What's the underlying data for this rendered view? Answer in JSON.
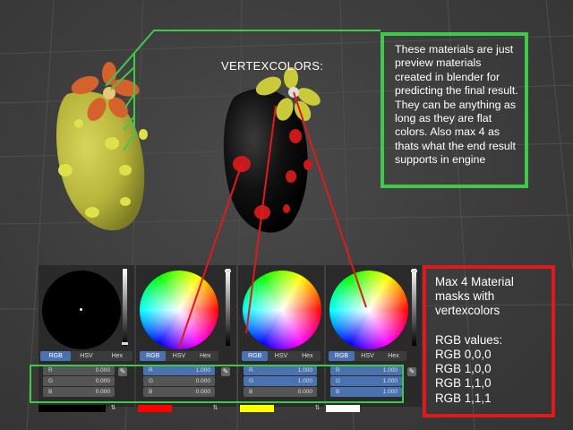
{
  "viewport": {
    "label_vertexcolors": "VERTEXCOLORS:",
    "note_green": "These materials are just preview materials created in blender for predicting the final result. They can be anything as long as they are flat colors. Also max 4 as thats what the end result supports in engine",
    "note_red_title": "Max 4 Material masks with vertexcolors",
    "note_red_subtitle": "RGB values:",
    "note_red_values": [
      "RGB 0,0,0",
      "RGB 1,0,0",
      "RGB 1,1,0",
      "RGB 1,1,1"
    ]
  },
  "colors": {
    "green_outline": "#3ec94a",
    "red_outline": "#e01a1a",
    "active_tab": "#4a72b0"
  },
  "color_panels": [
    {
      "tabs": [
        "RGB",
        "HSV",
        "Hex"
      ],
      "active_tab": "RGB",
      "fields": [
        {
          "label": "R",
          "value": "0.000"
        },
        {
          "label": "G",
          "value": "0.000"
        },
        {
          "label": "B",
          "value": "0.000"
        }
      ],
      "swatch": "#000000"
    },
    {
      "tabs": [
        "RGB",
        "HSV",
        "Hex"
      ],
      "active_tab": "RGB",
      "fields": [
        {
          "label": "R",
          "value": "1.000"
        },
        {
          "label": "G",
          "value": "0.000"
        },
        {
          "label": "B",
          "value": "0.000"
        }
      ],
      "swatch": "#ff0000"
    },
    {
      "tabs": [
        "RGB",
        "HSV",
        "Hex"
      ],
      "active_tab": "RGB",
      "fields": [
        {
          "label": "R",
          "value": "1.000"
        },
        {
          "label": "G",
          "value": "1.000"
        },
        {
          "label": "B",
          "value": "0.000"
        }
      ],
      "swatch": "#ffff00"
    },
    {
      "tabs": [
        "RGB",
        "HSV",
        "Hex"
      ],
      "active_tab": "RGB",
      "fields": [
        {
          "label": "R",
          "value": "1.000"
        },
        {
          "label": "G",
          "value": "1.000"
        },
        {
          "label": "B",
          "value": "1.000"
        }
      ],
      "swatch": "#ffffff"
    }
  ]
}
